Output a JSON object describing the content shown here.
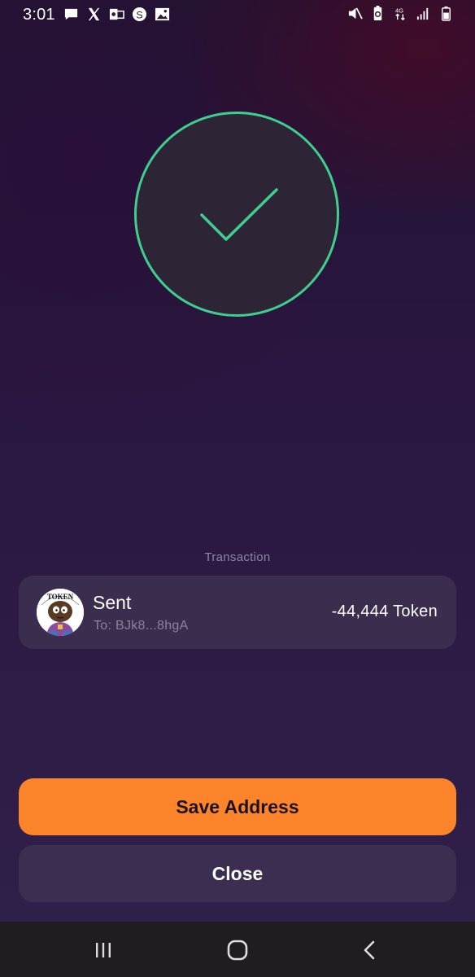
{
  "status_bar": {
    "time": "3:01",
    "left_icons": [
      "message-icon",
      "x-icon",
      "outlook-icon",
      "s-app-icon",
      "gallery-icon"
    ],
    "right_icons": [
      "mute-icon",
      "battery-saver-icon",
      "data-icon",
      "signal-icon",
      "battery-icon"
    ]
  },
  "success": {
    "icon": "checkmark-icon",
    "accent_color": "#3ecf8e"
  },
  "transaction": {
    "section_label": "Transaction",
    "title": "Sent",
    "to": "To: BJk8...8hgA",
    "amount": "-44,444 Token",
    "avatar_text": "TOKEN"
  },
  "buttons": {
    "save_label": "Save Address",
    "close_label": "Close",
    "primary_color": "#fc842a"
  },
  "nav_bar": {
    "icons": [
      "recent-apps-icon",
      "home-icon",
      "back-icon"
    ]
  }
}
